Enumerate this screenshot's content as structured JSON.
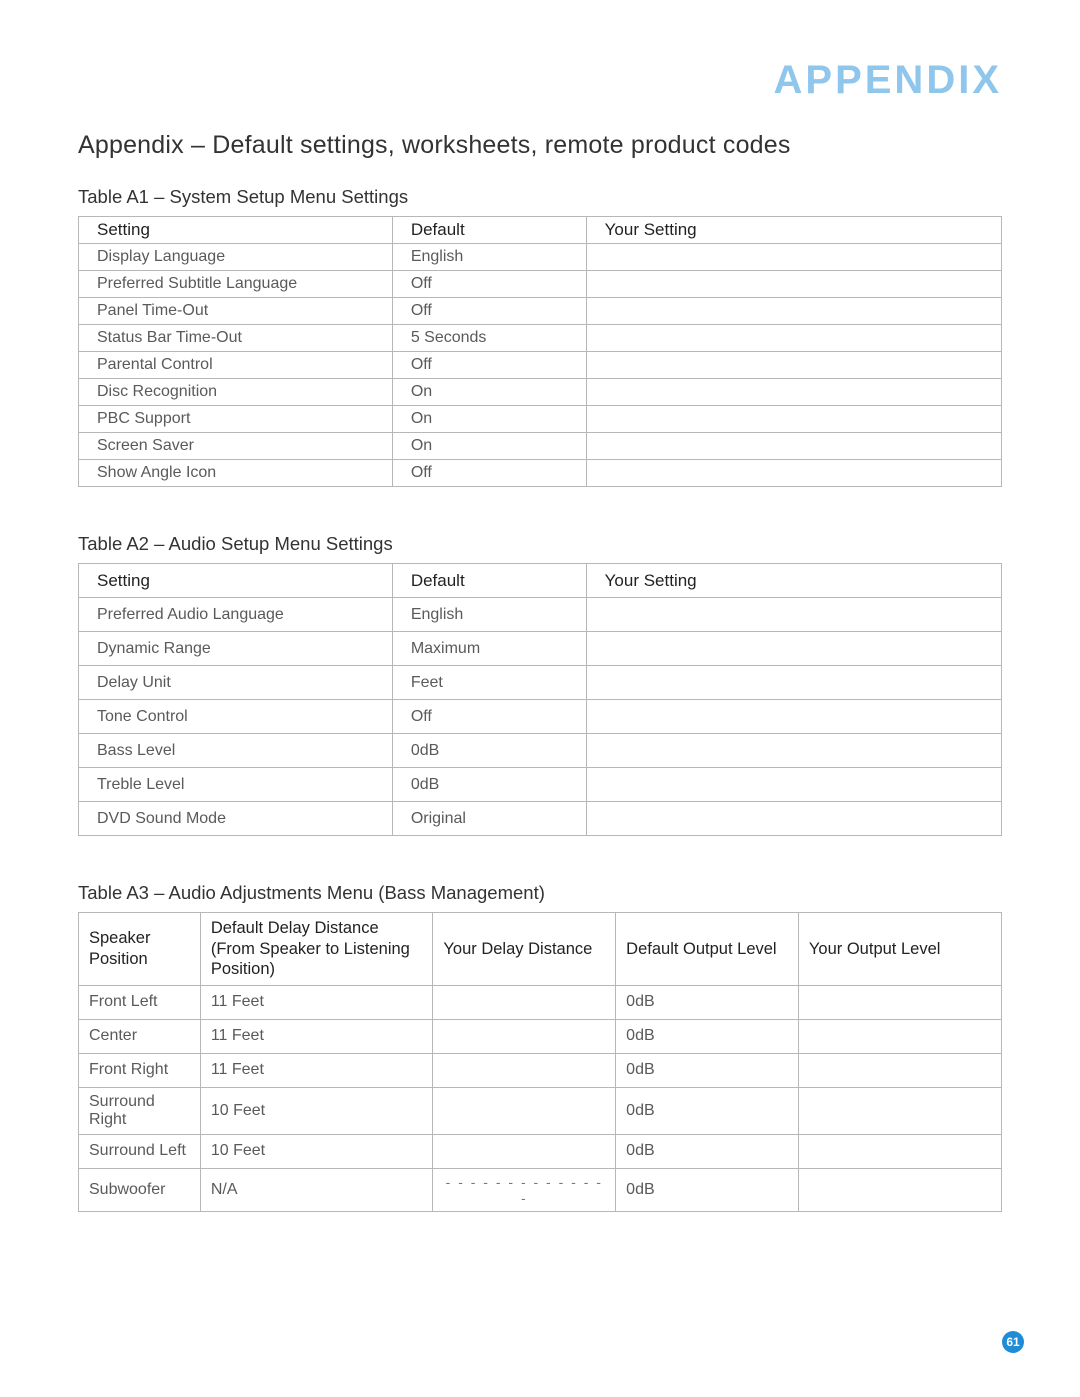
{
  "brand": "APPENDIX",
  "heading": "Appendix – Default settings, worksheets, remote product codes",
  "page_number": "61",
  "tables": {
    "a1": {
      "caption": "Table A1 – System Setup Menu Settings",
      "headers": [
        "Setting",
        "Default",
        "Your Setting"
      ],
      "rows": [
        {
          "setting": "Display Language",
          "default": "English",
          "your": ""
        },
        {
          "setting": "Preferred Subtitle Language",
          "default": "Off",
          "your": ""
        },
        {
          "setting": "Panel Time-Out",
          "default": "Off",
          "your": ""
        },
        {
          "setting": "Status Bar Time-Out",
          "default": "5 Seconds",
          "your": ""
        },
        {
          "setting": "Parental Control",
          "default": "Off",
          "your": ""
        },
        {
          "setting": "Disc Recognition",
          "default": "On",
          "your": ""
        },
        {
          "setting": "PBC Support",
          "default": "On",
          "your": ""
        },
        {
          "setting": "Screen Saver",
          "default": "On",
          "your": ""
        },
        {
          "setting": "Show Angle Icon",
          "default": "Off",
          "your": ""
        }
      ]
    },
    "a2": {
      "caption": "Table A2 – Audio Setup Menu Settings",
      "headers": [
        "Setting",
        "Default",
        "Your Setting"
      ],
      "rows": [
        {
          "setting": "Preferred Audio Language",
          "default": "English",
          "your": ""
        },
        {
          "setting": "Dynamic Range",
          "default": "Maximum",
          "your": ""
        },
        {
          "setting": "Delay Unit",
          "default": "Feet",
          "your": ""
        },
        {
          "setting": "Tone Control",
          "default": "Off",
          "your": ""
        },
        {
          "setting": "Bass Level",
          "default": "0dB",
          "your": ""
        },
        {
          "setting": "Treble Level",
          "default": "0dB",
          "your": ""
        },
        {
          "setting": "DVD Sound Mode",
          "default": "Original",
          "your": ""
        }
      ]
    },
    "a3": {
      "caption": "Table A3 – Audio Adjustments Menu (Bass Management)",
      "headers": [
        "Speaker Position",
        "Default Delay Distance (From Speaker to Listening Position)",
        "Your Delay Distance",
        "Default Output Level",
        "Your Output Level"
      ],
      "rows": [
        {
          "pos": "Front Left",
          "ddist": "11 Feet",
          "ydist": "",
          "dlvl": "0dB",
          "ylvl": ""
        },
        {
          "pos": "Center",
          "ddist": "11 Feet",
          "ydist": "",
          "dlvl": "0dB",
          "ylvl": ""
        },
        {
          "pos": "Front Right",
          "ddist": "11 Feet",
          "ydist": "",
          "dlvl": "0dB",
          "ylvl": ""
        },
        {
          "pos": "Surround Right",
          "ddist": "10 Feet",
          "ydist": "",
          "dlvl": "0dB",
          "ylvl": ""
        },
        {
          "pos": "Surround Left",
          "ddist": "10 Feet",
          "ydist": "",
          "dlvl": "0dB",
          "ylvl": ""
        },
        {
          "pos": "Subwoofer",
          "ddist": "N/A",
          "ydist": "- - - - - - - - - - - - - -",
          "dlvl": "0dB",
          "ylvl": ""
        }
      ]
    }
  }
}
